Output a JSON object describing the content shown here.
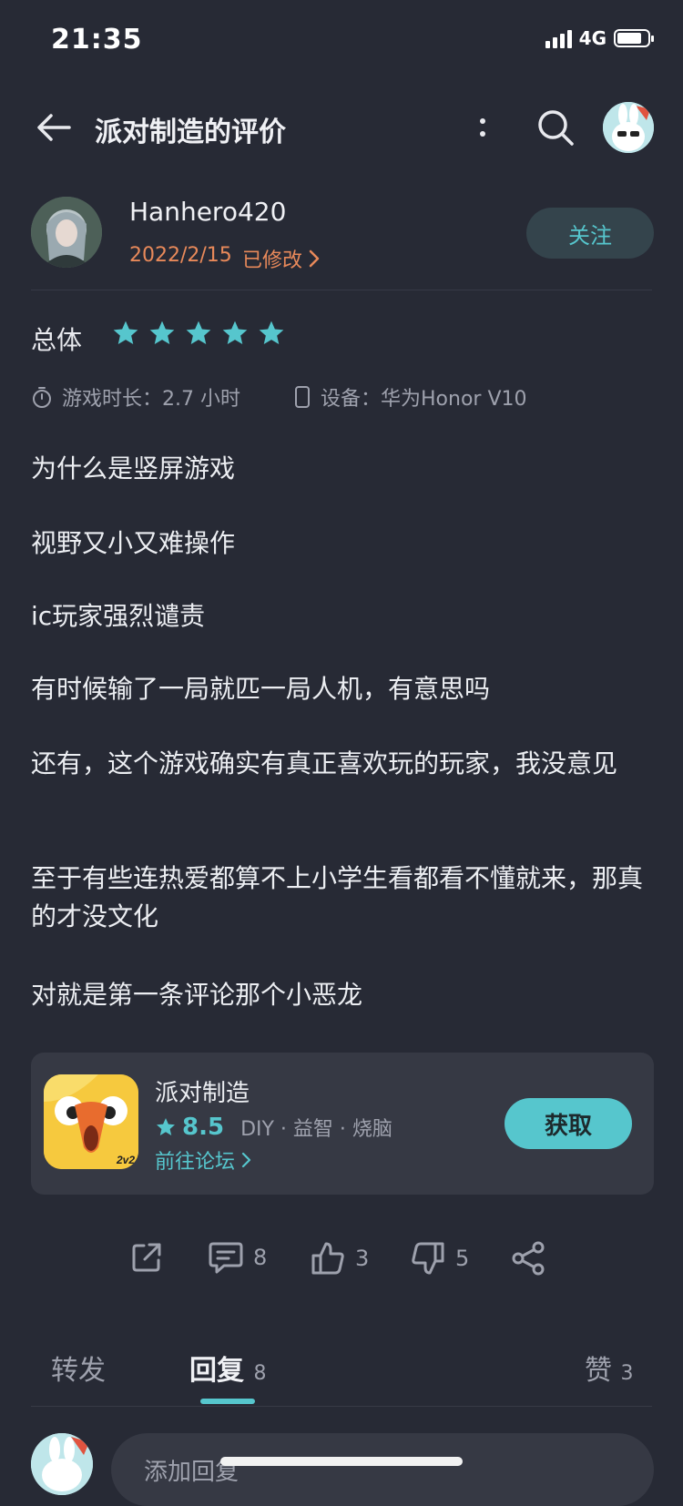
{
  "status_bar": {
    "time": "21:35",
    "network": "4G"
  },
  "header": {
    "title": "派对制造的评价"
  },
  "author": {
    "name": "Hanhero420",
    "date": "2022/2/15",
    "edited_label": "已修改",
    "follow_label": "关注"
  },
  "rating": {
    "label": "总体",
    "stars": 5,
    "max_stars": 5
  },
  "meta": {
    "playtime": "游戏时长：2.7 小时",
    "device": "设备：华为Honor V10"
  },
  "review_paragraphs": [
    "为什么是竖屏游戏",
    "视野又小又难操作",
    "ic玩家强烈谴责",
    "有时候输了一局就匹一局人机，有意思吗",
    "还有，这个游戏确实有真正喜欢玩的玩家，我没意见",
    "至于有些连热爱都算不上小学生看都看不懂就来，那真的才没文化",
    "对就是第一条评论那个小恶龙"
  ],
  "app_card": {
    "name": "派对制造",
    "score": "8.5",
    "tags": "DIY · 益智 · 烧脑",
    "forum_link": "前往论坛",
    "get_label": "获取",
    "icon_badge": "2v2"
  },
  "actions": {
    "comments": "8",
    "likes": "3",
    "dislikes": "5"
  },
  "tabs": {
    "forward": "转发",
    "reply": "回复",
    "reply_count": "8",
    "like": "赞",
    "like_count": "3"
  },
  "reply_box": {
    "placeholder": "添加回复"
  },
  "colors": {
    "background": "#272a35",
    "accent": "#56c6cd",
    "date": "#e8895a",
    "muted": "#9ea1ad"
  }
}
